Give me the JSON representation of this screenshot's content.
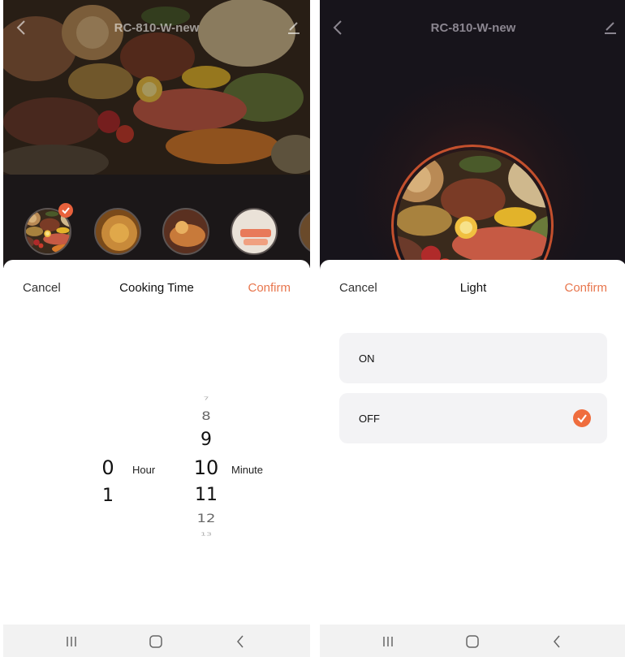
{
  "left_screen": {
    "header": {
      "title": "RC-810-W-new"
    },
    "sheet": {
      "cancel_label": "Cancel",
      "title": "Cooking Time",
      "confirm_label": "Confirm"
    },
    "picker": {
      "hour": {
        "values": [
          "0",
          "1"
        ],
        "selected": "0",
        "unit": "Hour"
      },
      "minute": {
        "values": [
          "7",
          "8",
          "9",
          "10",
          "11",
          "12",
          "13"
        ],
        "selected": "10",
        "unit": "Minute"
      }
    }
  },
  "right_screen": {
    "header": {
      "title": "RC-810-W-new"
    },
    "sheet": {
      "cancel_label": "Cancel",
      "title": "Light",
      "confirm_label": "Confirm"
    },
    "options": [
      {
        "label": "ON",
        "selected": false
      },
      {
        "label": "OFF",
        "selected": true
      }
    ]
  },
  "icons": {
    "back": "chevron-left-icon",
    "edit": "edit-pencil-icon",
    "check": "check-icon",
    "nav_recents": "recents-icon",
    "nav_home": "home-icon",
    "nav_back": "back-icon"
  },
  "colors": {
    "accent": "#e8764d",
    "check": "#ef6d3e",
    "ring": "#c4502d",
    "option_bg": "#f3f3f5",
    "dark_bg": "#16131a"
  }
}
